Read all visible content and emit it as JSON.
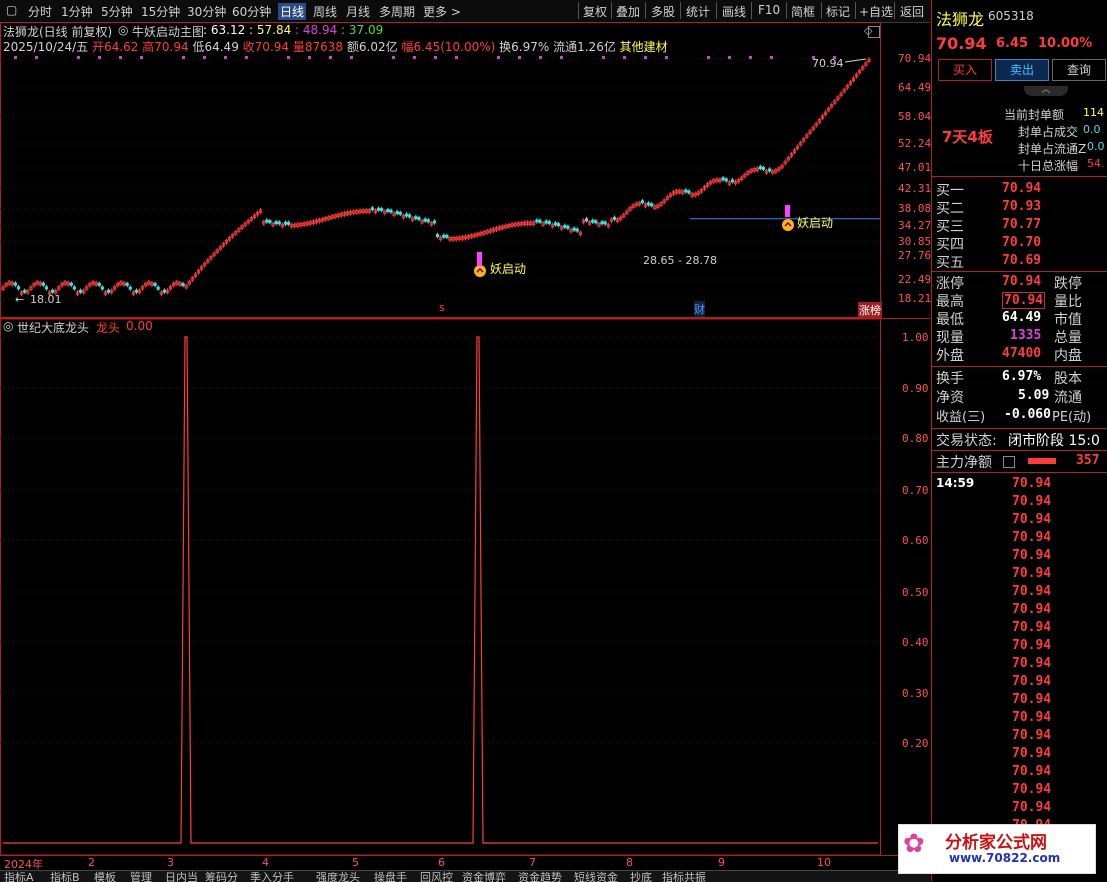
{
  "toolbar": {
    "left_items": [
      "分时",
      "1分钟",
      "5分钟",
      "15分钟",
      "30分钟",
      "60分钟",
      "日线",
      "周线",
      "月线",
      "多周期",
      "更多 >"
    ],
    "active": "日线",
    "right_items": [
      "复权",
      "叠加",
      "多股",
      "统计",
      "画线",
      "F10",
      "简框",
      "标记",
      "+自选",
      "返回"
    ]
  },
  "main_chart": {
    "title": "法狮龙(日线 前复权)",
    "indicator_name": "牛妖启动主图",
    "ma_values": [
      ": 63.12",
      ": 57.84",
      ": 48.94",
      ": 37.09"
    ],
    "ohlc": {
      "date": "2025/10/24/五",
      "open_label": "开",
      "open": "64.62",
      "high_label": "高",
      "high": "70.94",
      "low_label": "低",
      "low": "64.49",
      "close_label": "收",
      "close": "70.94",
      "vol_label": "量",
      "vol": "87638",
      "amount_label": "额",
      "amount": "6.02亿",
      "change_label": "幅",
      "change": "6.45(10.00%)",
      "turnover": "换6.97%",
      "float": "流通1.26亿",
      "sector": "其他建材"
    },
    "price_axis": [
      "70.94",
      "64.49",
      "58.04",
      "52.24",
      "47.01",
      "42.31",
      "38.08",
      "34.27",
      "30.85",
      "27.76",
      "22.49",
      "18.21"
    ],
    "annotations": {
      "high_label": "70.94",
      "low_label": "18.01",
      "range_label": "28.65 - 28.78",
      "signal1": "妖启动",
      "signal2": "妖启动",
      "marker_s": "s",
      "marker_cai": "财",
      "marker_zhangbang": "涨榜"
    }
  },
  "sub_chart": {
    "title": "世纪大底龙头",
    "series_label": "龙头",
    "series_value": "0.00",
    "axis": [
      "1.00",
      "0.90",
      "0.80",
      "0.70",
      "0.60",
      "0.50",
      "0.40",
      "0.30",
      "0.20"
    ]
  },
  "date_axis": [
    "2024年",
    "2",
    "3",
    "4",
    "5",
    "6",
    "7",
    "8",
    "9",
    "10"
  ],
  "bottom_tabs": [
    "指标A",
    "指标B",
    "模板",
    "管理",
    "日内当",
    "筹码分",
    "季入分手",
    "强度龙头",
    "操盘手",
    "回风控",
    "资金博弈",
    "资金趋势",
    "短线资金",
    "抄底",
    "指标共振"
  ],
  "right_panel": {
    "name": "法狮龙",
    "code": "605318",
    "price": "70.94",
    "change": "6.45",
    "change_pct": "10.00%",
    "buttons": [
      "买入",
      "卖出",
      "查询"
    ],
    "board_tag": "7天4板",
    "seal_rows": [
      {
        "label": "当前封单额",
        "value": "114"
      },
      {
        "label": "封单占成交",
        "value": "0.0"
      },
      {
        "label": "封单占流通Z",
        "value": "0.0"
      },
      {
        "label": "十日总涨幅",
        "value": "54."
      }
    ],
    "buy_rows": [
      {
        "label": "买一",
        "value": "70.94"
      },
      {
        "label": "买二",
        "value": "70.93"
      },
      {
        "label": "买三",
        "value": "70.77"
      },
      {
        "label": "买四",
        "value": "70.70"
      },
      {
        "label": "买五",
        "value": "70.69"
      }
    ],
    "stats": [
      {
        "label": "涨停",
        "value": "70.94",
        "label2": "跌停"
      },
      {
        "label": "最高",
        "value": "70.94",
        "label2": "量比"
      },
      {
        "label": "最低",
        "value": "64.49",
        "label2": "市值"
      },
      {
        "label": "现量",
        "value": "1335",
        "label2": "总量"
      },
      {
        "label": "外盘",
        "value": "47400",
        "label2": "内盘"
      }
    ],
    "stats2": [
      {
        "label": "换手",
        "value": "6.97%",
        "label2": "股本"
      },
      {
        "label": "净资",
        "value": "5.09",
        "label2": "流通"
      },
      {
        "label": "收益(三)",
        "value": "-0.060",
        "label2": "PE(动)"
      }
    ],
    "trade_status_label": "交易状态:",
    "trade_status": "闭市阶段 15:0",
    "main_net_label": "主力净额",
    "main_net_value": "357",
    "tick_time": "14:59",
    "tick_prices": [
      "70.94",
      "70.94",
      "70.94",
      "70.94",
      "70.94",
      "70.94",
      "70.94",
      "70.94",
      "70.94",
      "70.94",
      "70.94",
      "70.94",
      "70.94",
      "70.94",
      "70.94",
      "70.94",
      "70.94",
      "70.94",
      "70.94",
      "70.94"
    ],
    "logo_text": "分析家公式网",
    "logo_url": "www.70822.com"
  },
  "colors": {
    "up": "#ff3c3c",
    "down": "#40e0e0",
    "ma1": "#ffffff",
    "ma2": "#ffff40",
    "ma3": "#e040e0",
    "ma4": "#40e040",
    "accent": "#b02020"
  }
}
